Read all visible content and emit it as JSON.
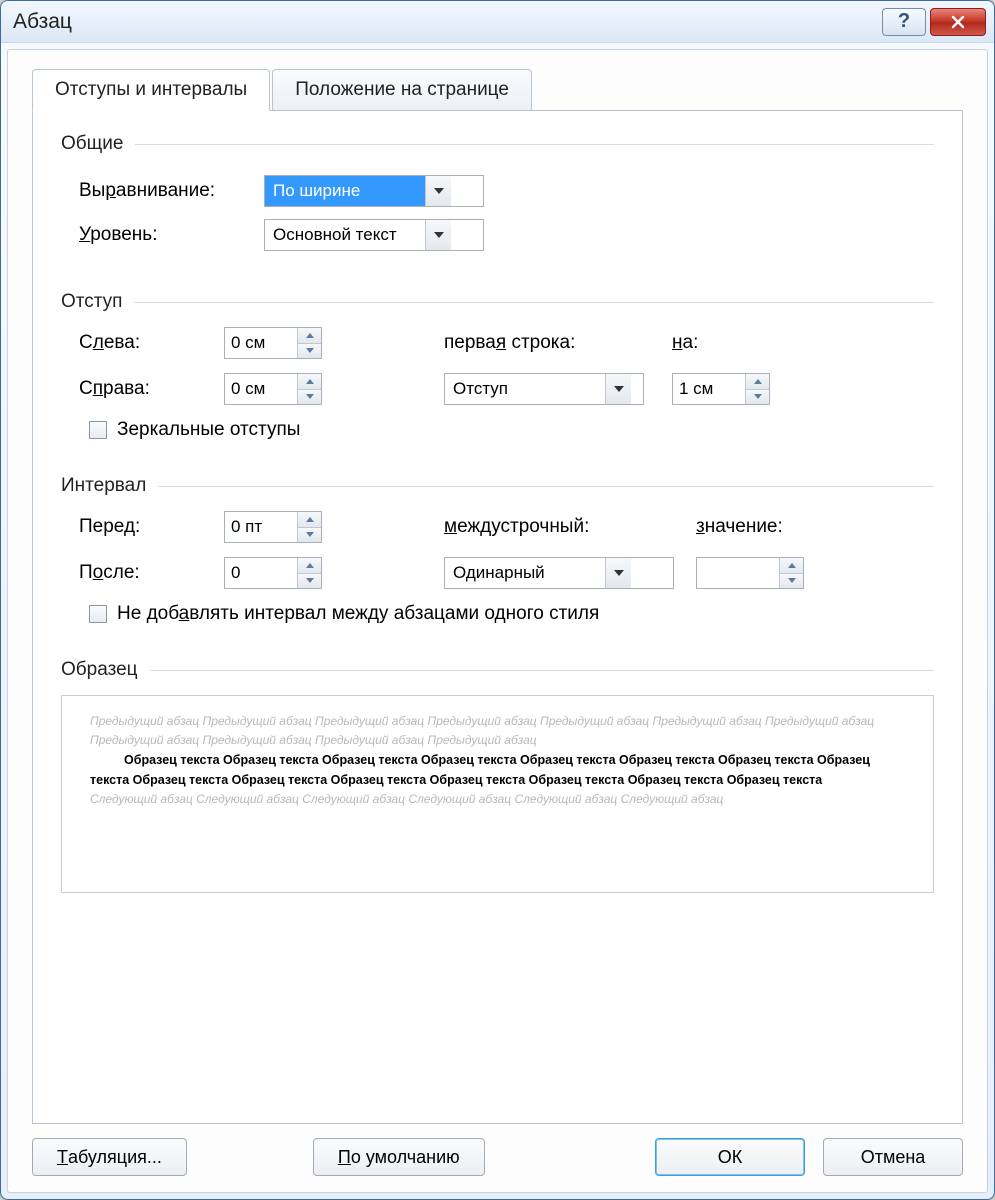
{
  "window": {
    "title": "Абзац"
  },
  "tabs": {
    "indents": "Отступы и интервалы",
    "position": "Положение на странице"
  },
  "general": {
    "title": "Общие",
    "alignment_label": "Выравнивание:",
    "alignment_value": "По ширине",
    "level_label": "Уровень:",
    "level_value": "Основной текст"
  },
  "indent": {
    "title": "Отступ",
    "left_label": "Слева:",
    "left_value": "0 см",
    "right_label": "Справа:",
    "right_value": "0 см",
    "firstline_label": "первая строка:",
    "firstline_value": "Отступ",
    "by_label": "на:",
    "by_value": "1 см",
    "mirror_label": "Зеркальные отступы"
  },
  "spacing": {
    "title": "Интервал",
    "before_label": "Перед:",
    "before_value": "0 пт",
    "after_label": "После:",
    "after_value": "0",
    "linespacing_label": "междустрочный:",
    "linespacing_value": "Одинарный",
    "at_label": "значение:",
    "at_value": "",
    "nospace_label": "Не добавлять интервал между абзацами одного стиля"
  },
  "preview": {
    "title": "Образец",
    "prev_para": "Предыдущий абзац Предыдущий абзац Предыдущий абзац Предыдущий абзац Предыдущий абзац Предыдущий абзац Предыдущий абзац Предыдущий абзац Предыдущий абзац Предыдущий абзац Предыдущий абзац",
    "sample": "Образец текста Образец текста Образец текста Образец текста Образец текста Образец текста Образец текста Образец текста Образец текста Образец текста Образец текста Образец текста Образец текста Образец текста Образец текста",
    "next_para": "Следующий абзац Следующий абзац Следующий абзац Следующий абзац Следующий абзац Следующий абзац"
  },
  "buttons": {
    "tabs": "Табуляция...",
    "default": "По умолчанию",
    "ok": "ОК",
    "cancel": "Отмена"
  }
}
